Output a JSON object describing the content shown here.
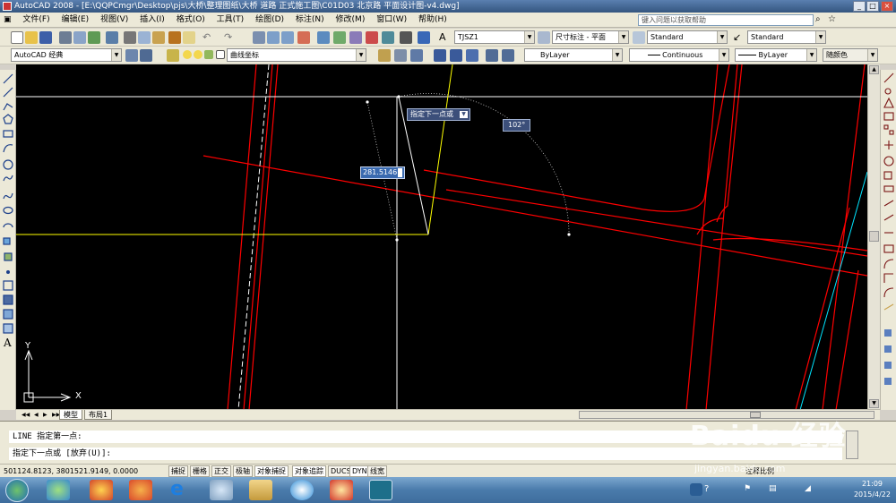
{
  "window": {
    "title": "AutoCAD 2008 - [E:\\QQPCmgr\\Desktop\\pjs\\大桥\\整理图纸\\大桥 道路 正式施工图\\C01D03 北京路 平面设计图-v4.dwg]",
    "minimize": "_",
    "maximize": "□",
    "close": "×"
  },
  "menu": {
    "items": [
      "文件(F)",
      "编辑(E)",
      "视图(V)",
      "插入(I)",
      "格式(O)",
      "工具(T)",
      "绘图(D)",
      "标注(N)",
      "修改(M)",
      "窗口(W)",
      "帮助(H)"
    ],
    "help_search_placeholder": "键入问题以获取帮助"
  },
  "toolbar1": {
    "text_style": "TJSZ1",
    "dim_style": "尺寸标注 - 平面",
    "table_style": "Standard",
    "multileader_style": "Standard"
  },
  "toolbar2": {
    "workspace": "AutoCAD 经典",
    "layer": "曲线坐标",
    "color": "ByLayer",
    "linetype": "Continuous",
    "lineweight": "ByLayer",
    "plotstyle": "随颜色"
  },
  "canvas": {
    "tooltip_prompt": "指定下一点或",
    "length_input": "281.5146",
    "angle_input": "102°",
    "ucs_x": "X",
    "ucs_y": "Y"
  },
  "layout_tabs": {
    "nav": [
      "◀◀",
      "◀",
      "▶",
      "▶▶"
    ],
    "model": "模型",
    "layout1": "布局1"
  },
  "command": {
    "line1": "LINE 指定第一点:",
    "line2": "指定下一点或 [放弃(U)]:"
  },
  "status": {
    "coords": "501124.8123, 3801521.9149, 0.0000",
    "buttons": [
      "捕捉",
      "栅格",
      "正交",
      "极轴",
      "对象捕捉",
      "对象追踪",
      "DUCS",
      "DYN",
      "线宽"
    ],
    "annotation_scale": "注释比例"
  },
  "taskbar": {
    "time": "21:09",
    "date": "2015/4/22"
  },
  "watermark": {
    "main": "Baidu 经验",
    "sub": "jingyan.baidu.com"
  },
  "colors": {
    "canvas_bg": "#000000",
    "road_red": "#ff0000",
    "construction_yellow": "#ffff00",
    "cyan_line": "#00e5ff",
    "crosshair": "#ffffff"
  }
}
